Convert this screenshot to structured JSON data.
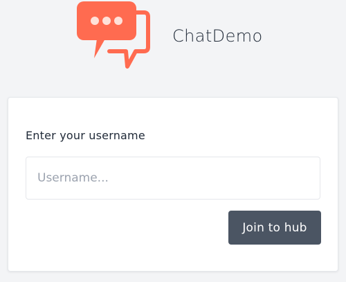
{
  "brand": {
    "title": "ChatDemo",
    "logo_icon": "chat-bubbles-icon",
    "accent_color": "#ff6b50"
  },
  "login": {
    "label": "Enter your username",
    "username_placeholder": "Username...",
    "username_value": "",
    "join_label": "Join to hub"
  }
}
